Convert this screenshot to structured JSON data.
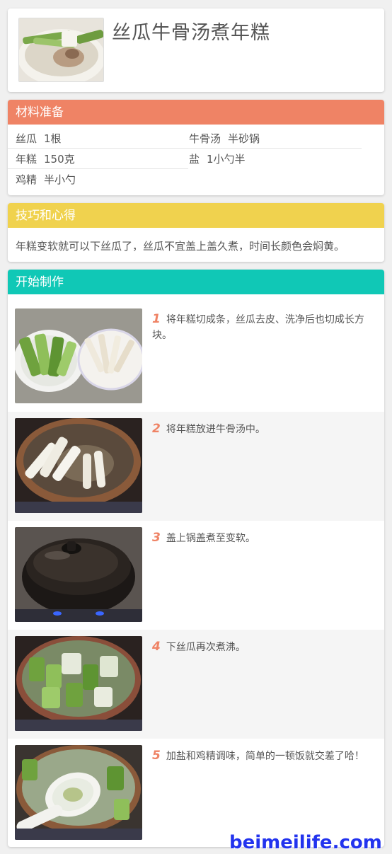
{
  "recipe": {
    "title": "丝瓜牛骨汤煮年糕",
    "thumbnail_icon": "soup-photo-icon"
  },
  "ingredients": {
    "heading": "材料准备",
    "color": "#ef8365",
    "items": [
      {
        "name": "丝瓜",
        "qty": "1根"
      },
      {
        "name": "牛骨汤",
        "qty": "半砂锅"
      },
      {
        "name": "年糕",
        "qty": "150克"
      },
      {
        "name": "盐",
        "qty": "1小勺半"
      },
      {
        "name": "鸡精",
        "qty": "半小勺"
      }
    ]
  },
  "tips": {
    "heading": "技巧和心得",
    "color": "#f0d24e",
    "text": "年糕变软就可以下丝瓜了，丝瓜不宜盖上盖久煮，时间长颜色会焖黄。"
  },
  "steps": {
    "heading": "开始制作",
    "color": "#10c8b6",
    "items": [
      {
        "num": "1",
        "text": "将年糕切成条，丝瓜去皮、洗净后也切成长方块。",
        "photo_icon": "cut-ingredients-photo-icon"
      },
      {
        "num": "2",
        "text": "将年糕放进牛骨汤中。",
        "photo_icon": "ricecake-in-pot-photo-icon"
      },
      {
        "num": "3",
        "text": "盖上锅盖煮至变软。",
        "photo_icon": "covered-pot-photo-icon"
      },
      {
        "num": "4",
        "text": "下丝瓜再次煮沸。",
        "photo_icon": "loofah-in-pot-photo-icon"
      },
      {
        "num": "5",
        "text": "加盐和鸡精调味，简单的一顿饭就交差了哈！",
        "photo_icon": "seasoning-spoon-photo-icon"
      }
    ]
  },
  "watermark": "beimeilife.com"
}
